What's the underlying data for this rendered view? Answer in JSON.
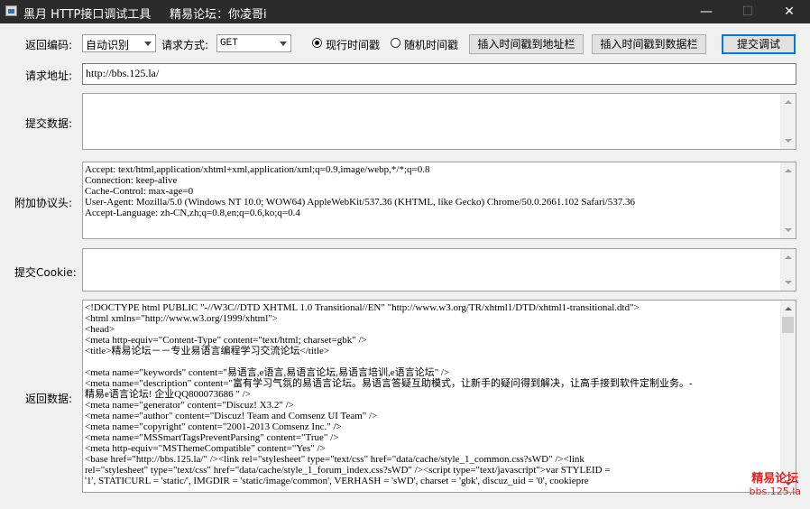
{
  "window": {
    "title": "黑月 HTTP接口调试工具     精易论坛：你凌哥i",
    "minimize": "—",
    "maximize": "☐",
    "close": "✕"
  },
  "toolbar": {
    "encoding_label": "返回编码:",
    "encoding_value": "自动识别",
    "method_label": "请求方式:",
    "method_value": "GET",
    "radio_current": "现行时间戳",
    "radio_random": "随机时间戳",
    "insert_url_button": "插入时间戳到地址栏",
    "insert_data_button": "插入时间戳到数据栏",
    "submit_button": "提交调试"
  },
  "url": {
    "label": "请求地址:",
    "value": "http://bbs.125.la/"
  },
  "post_data": {
    "label": "提交数据:",
    "value": ""
  },
  "headers": {
    "label": "附加协议头:",
    "value": "Accept: text/html,application/xhtml+xml,application/xml;q=0.9,image/webp,*/*;q=0.8\nConnection: keep-alive\nCache-Control: max-age=0\nUser-Agent: Mozilla/5.0 (Windows NT 10.0; WOW64) AppleWebKit/537.36 (KHTML, like Gecko) Chrome/50.0.2661.102 Safari/537.36\nAccept-Language: zh-CN,zh;q=0.8,en;q=0.6,ko;q=0.4"
  },
  "cookie": {
    "label": "提交Cookie:",
    "value": ""
  },
  "response": {
    "label": "返回数据:",
    "value": "<!DOCTYPE html PUBLIC \"-//W3C//DTD XHTML 1.0 Transitional//EN\" \"http://www.w3.org/TR/xhtml1/DTD/xhtml1-transitional.dtd\">\n<html xmlns=\"http://www.w3.org/1999/xhtml\">\n<head>\n<meta http-equiv=\"Content-Type\" content=\"text/html; charset=gbk\" />\n<title>精易论坛－－专业易语言编程学习交流论坛</title>\n\n<meta name=\"keywords\" content=\"易语言,e语言,易语言论坛,易语言培训,e语言论坛\" />\n<meta name=\"description\" content=\"富有学习气氛的易语言论坛。易语言答疑互助模式，让新手的疑问得到解决，让高手接到软件定制业务。-\n精易e语言论坛! 企业QQ800073686 \" />\n<meta name=\"generator\" content=\"Discuz! X3.2\" />\n<meta name=\"author\" content=\"Discuz! Team and Comsenz UI Team\" />\n<meta name=\"copyright\" content=\"2001-2013 Comsenz Inc.\" />\n<meta name=\"MSSmartTagsPreventParsing\" content=\"True\" />\n<meta http-equiv=\"MSThemeCompatible\" content=\"Yes\" />\n<base href=\"http://bbs.125.la/\" /><link rel=\"stylesheet\" type=\"text/css\" href=\"data/cache/style_1_common.css?sWD\" /><link\nrel=\"stylesheet\" type=\"text/css\" href=\"data/cache/style_1_forum_index.css?sWD\" /><script type=\"text/javascript\">var STYLEID =\n'1', STATICURL = 'static/', IMGDIR = 'static/image/common', VERHASH = 'sWD', charset = 'gbk', discuz_uid = '0', cookiepre"
  },
  "watermark": {
    "line1": "精易论坛",
    "line2": "bbs.125.la"
  }
}
